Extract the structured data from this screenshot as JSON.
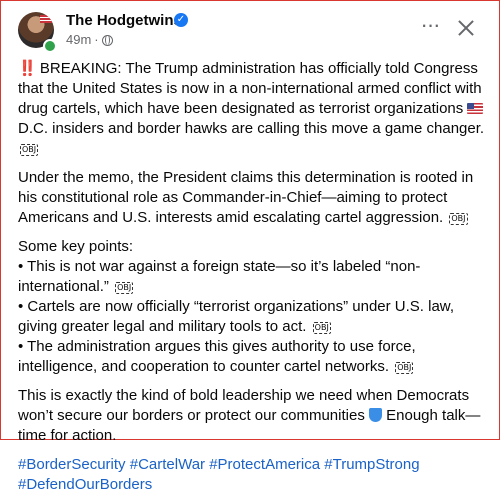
{
  "post": {
    "author": "The Hodgetwins",
    "time": "49m",
    "separator": "·",
    "more_label": "···",
    "paragraphs": {
      "p1": {
        "prefix": "‼️",
        "text_a": " BREAKING: The Trump administration has officially told Congress that the United States is now in a non-international armed conflict with drug cartels, which have been designated as terrorist organizations ",
        "text_b": " D.C. insiders and border hawks are calling this move a game changer. "
      },
      "p2": "Under the memo, the President claims this determination is rooted in his constitutional role as Commander-in-Chief—aiming to protect Americans and U.S. interests amid escalating cartel aggression. ",
      "p3": {
        "intro": "Some key points:",
        "b1": "• This is not war against a foreign state—so it’s labeled “non-international.” ",
        "b2": "• Cartels are now officially “terrorist organizations” under U.S. law, giving greater legal and military tools to act. ",
        "b3": "• The administration argues this gives authority to use force, intelligence, and cooperation to counter cartel networks. "
      },
      "p4": {
        "text_a": "This is exactly the kind of bold leadership we need when Democrats won’t secure our borders or protect our communities ",
        "text_b": " Enough talk—time for action."
      }
    },
    "obj_glyph": "OBJ",
    "hashtags": [
      "#BorderSecurity",
      "#CartelWar",
      "#ProtectAmerica",
      "#TrumpStrong",
      "#DefendOurBorders"
    ]
  },
  "colors": {
    "border": "#d8382f",
    "hashtag": "#1a62c7",
    "verified": "#1877f2",
    "online": "#31a24c"
  },
  "icons": [
    "verified-badge-icon",
    "globe-icon",
    "more-options-icon",
    "close-icon",
    "double-exclamation-icon",
    "us-flag-icon",
    "object-replacement-icon",
    "shield-icon"
  ]
}
